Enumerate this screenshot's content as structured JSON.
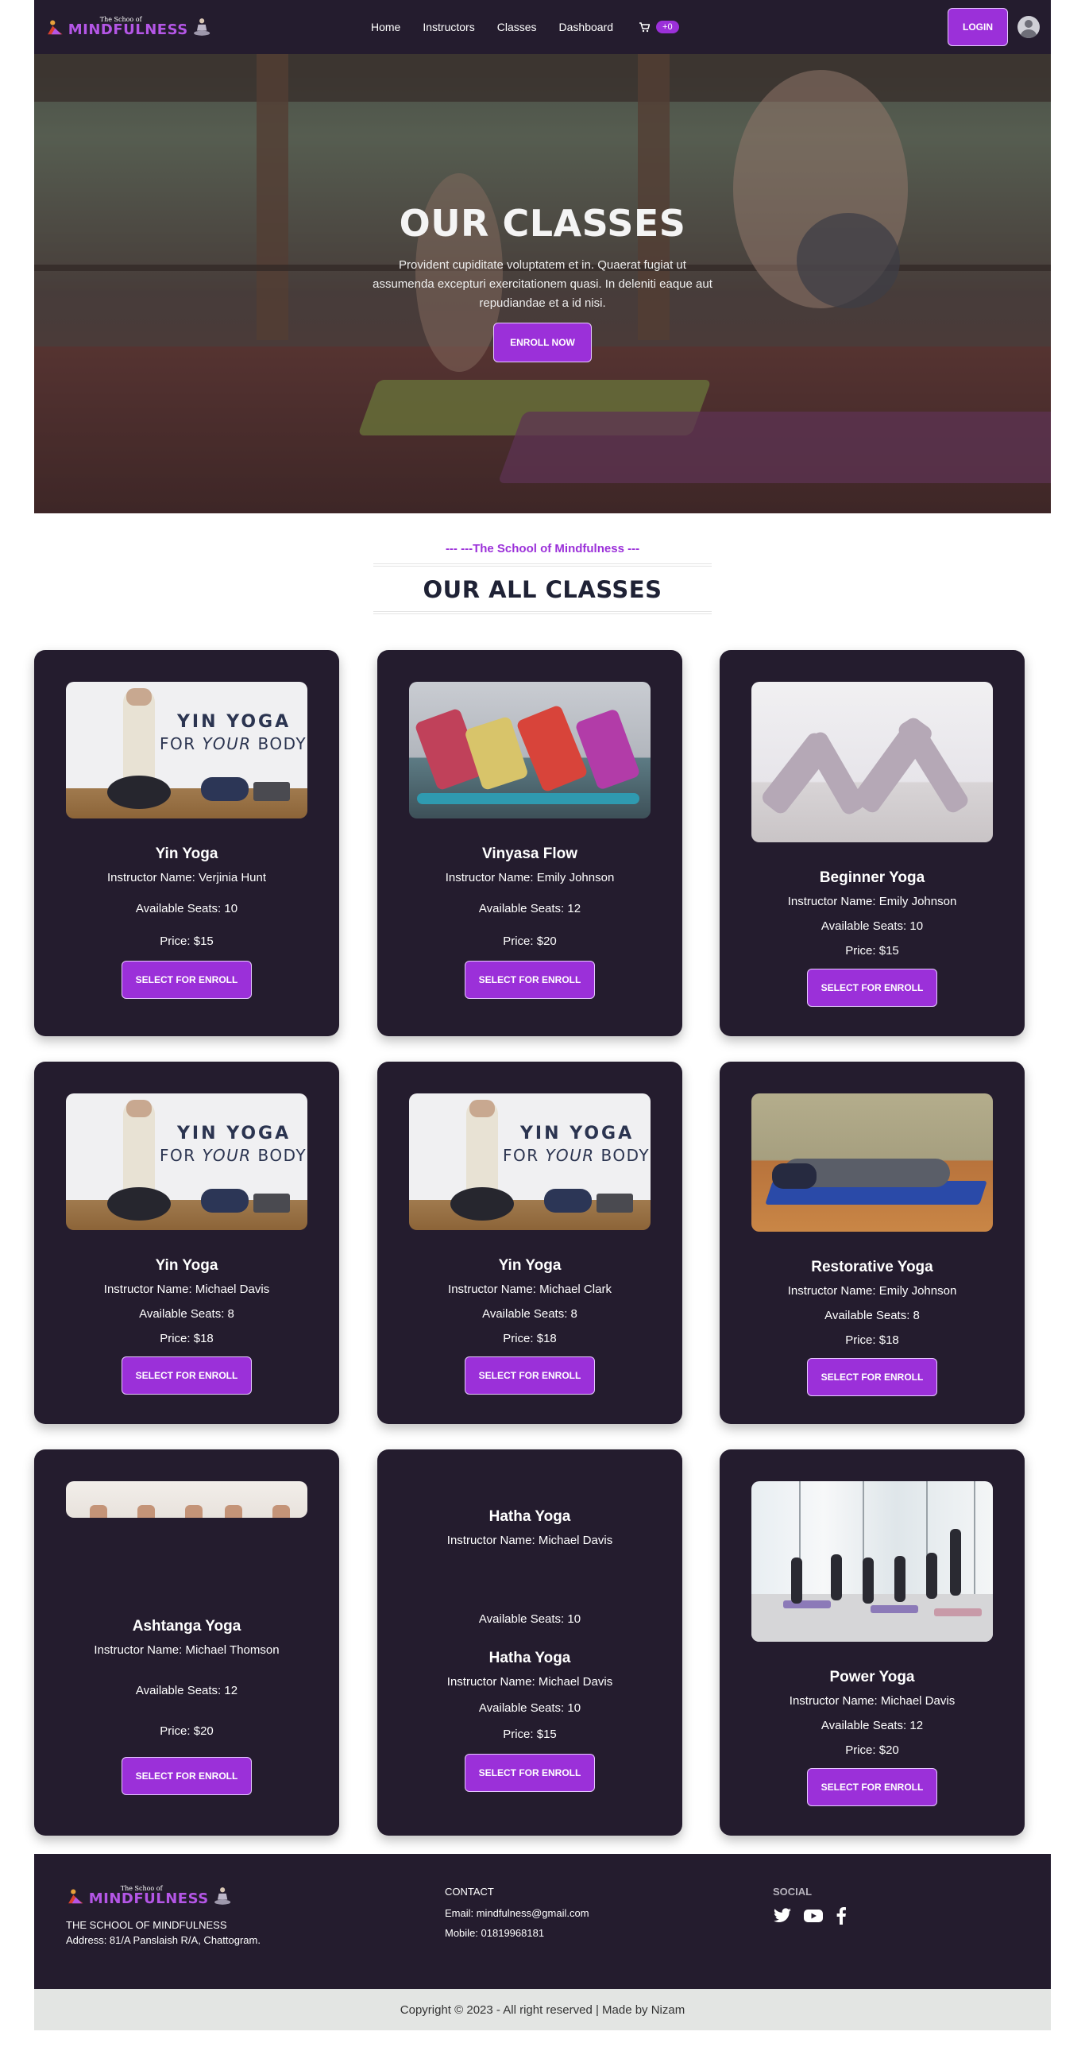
{
  "brand": {
    "small": "The Schoo of",
    "big": "MINDFULNESS"
  },
  "nav": {
    "links": [
      "Home",
      "Instructors",
      "Classes",
      "Dashboard"
    ],
    "cart_badge": "+0",
    "login_label": "LOGIN"
  },
  "hero": {
    "title": "OUR CLASSES",
    "text": "Provident cupiditate voluptatem et in. Quaerat fugiat ut assumenda excepturi exercitationem quasi. In deleniti eaque aut repudiandae et a id nisi.",
    "button": "ENROLL NOW"
  },
  "section": {
    "subtitle": "--- ---The School of Mindfulness ---",
    "title": "OUR ALL CLASSES"
  },
  "cards": [
    {
      "name": "Yin Yoga",
      "instructor": "Instructor Name: Verjinia Hunt",
      "seats": "Available Seats: 10",
      "price": "Price: $15",
      "button": "SELECT FOR ENROLL",
      "image_text_1": "YIN YOGA",
      "image_text_2a": "FOR ",
      "image_text_2b": "YOUR",
      "image_text_2c": " BODY"
    },
    {
      "name": "Vinyasa Flow",
      "instructor": "Instructor Name: Emily Johnson",
      "seats": "Available Seats: 12",
      "price": "Price: $20",
      "button": "SELECT FOR ENROLL"
    },
    {
      "name": "Beginner Yoga",
      "instructor": "Instructor Name: Emily Johnson",
      "seats": "Available Seats: 10",
      "price": "Price: $15",
      "button": "SELECT FOR ENROLL"
    },
    {
      "name": "Yin Yoga",
      "instructor": "Instructor Name: Michael Davis",
      "seats": "Available Seats: 8",
      "price": "Price: $18",
      "button": "SELECT FOR ENROLL",
      "image_text_1": "YIN YOGA",
      "image_text_2a": "FOR ",
      "image_text_2b": "YOUR",
      "image_text_2c": " BODY"
    },
    {
      "name": "Yin Yoga",
      "instructor": "Instructor Name: Michael Clark",
      "seats": "Available Seats: 8",
      "price": "Price: $18",
      "button": "SELECT FOR ENROLL",
      "image_text_1": "YIN YOGA",
      "image_text_2a": "FOR ",
      "image_text_2b": "YOUR",
      "image_text_2c": " BODY"
    },
    {
      "name": "Restorative Yoga",
      "instructor": "Instructor Name: Emily Johnson",
      "seats": "Available Seats: 8",
      "price": "Price: $18",
      "button": "SELECT FOR ENROLL"
    },
    {
      "name": "Ashtanga Yoga",
      "instructor": "Instructor Name: Michael Thomson",
      "seats": "Available Seats: 12",
      "price": "Price: $20",
      "button": "SELECT FOR ENROLL"
    },
    {
      "name": "Hatha Yoga",
      "instructor": "Instructor Name: Michael Davis",
      "seats": "Available Seats: 10",
      "name_2": "Hatha Yoga",
      "instructor_2": "Instructor Name: Michael Davis",
      "seats_2": "Available Seats: 10",
      "price": "Price: $15",
      "button": "SELECT FOR ENROLL"
    },
    {
      "name": "Power Yoga",
      "instructor": "Instructor Name: Michael Davis",
      "seats": "Available Seats: 12",
      "price": "Price: $20",
      "button": "SELECT FOR ENROLL"
    }
  ],
  "footer": {
    "school_name": "THE SCHOOL OF MINDFULNESS",
    "address": "Address: 81/A Panslaish R/A, Chattogram.",
    "contact_head": "CONTACT",
    "email": "Email: mindfulness@gmail.com",
    "mobile": "Mobile: 01819968181",
    "social_head": "SOCIAL",
    "copyright": "Copyright © 2023 - All right reserved | Made by Nizam"
  },
  "colors": {
    "accent": "#9b30d9",
    "dark": "#241c2e"
  },
  "icons": [
    "cart-icon",
    "avatar-icon",
    "twitter-icon",
    "youtube-icon",
    "facebook-icon"
  ]
}
